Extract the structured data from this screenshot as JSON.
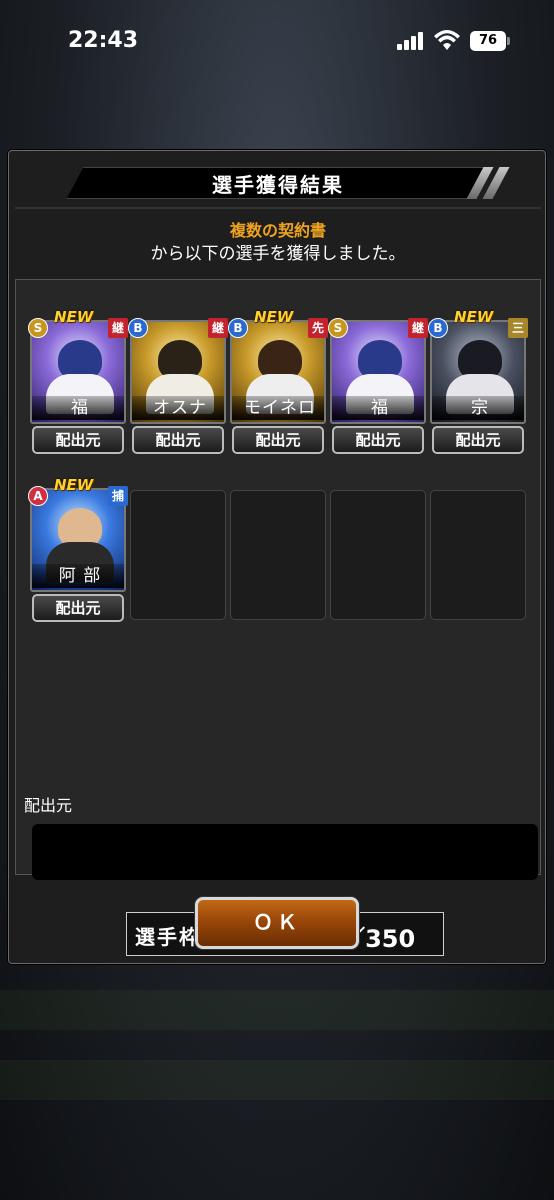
{
  "status": {
    "time": "22:43",
    "battery": "76"
  },
  "dialog": {
    "title": "選手獲得結果",
    "source_item": "複数の契約書",
    "message": "から以下の選手を獲得しました。",
    "source_label": "配出元",
    "slot_label": "選手枠：",
    "slot_value": "317／350",
    "ok_label": "ＯＫ"
  },
  "cards": [
    {
      "name": "福",
      "rank": "S",
      "position": "継",
      "new": "NEW",
      "button": "配出元",
      "rank_color": "#c8961c",
      "pos_color": "#c4232d",
      "bg": "#5c3aa0"
    },
    {
      "name": "オスナ",
      "rank": "B",
      "position": "継",
      "new": "",
      "button": "配出元",
      "rank_color": "#2a6ad0",
      "pos_color": "#c4232d",
      "bg": "#a07820"
    },
    {
      "name": "モイネロ",
      "rank": "B",
      "position": "先",
      "new": "NEW",
      "button": "配出元",
      "rank_color": "#2a6ad0",
      "pos_color": "#c4232d",
      "bg": "#8a6a18"
    },
    {
      "name": "福",
      "rank": "S",
      "position": "継",
      "new": "",
      "button": "配出元",
      "rank_color": "#c8961c",
      "pos_color": "#c4232d",
      "bg": "#5c3aa0"
    },
    {
      "name": "宗",
      "rank": "B",
      "position": "三",
      "new": "NEW",
      "button": "配出元",
      "rank_color": "#2a6ad0",
      "pos_color": "#a8862a",
      "bg": "#3a3f4a"
    },
    {
      "name": "阿 部",
      "rank": "A",
      "position": "捕",
      "new": "NEW",
      "button": "配出元",
      "rank_color": "#d03040",
      "pos_color": "#2a6ad0",
      "bg": "#2a5cc0"
    }
  ]
}
